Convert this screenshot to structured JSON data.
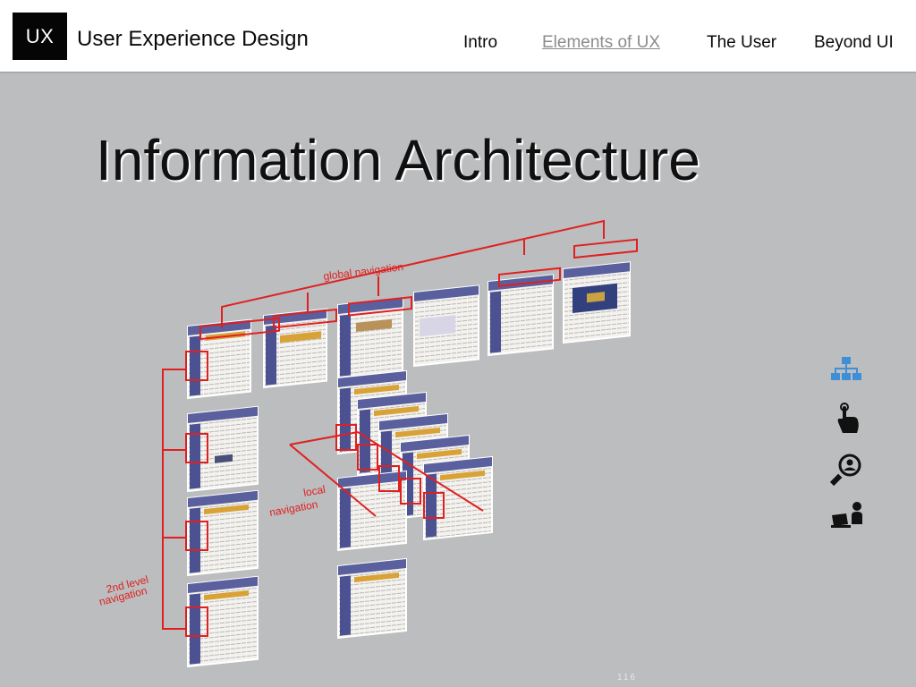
{
  "header": {
    "logo": "UX",
    "brand": "User Experience Design",
    "nav": [
      "Intro",
      "Elements of UX",
      "The User",
      "Beyond UI"
    ],
    "active_nav": "Elements of UX"
  },
  "slide": {
    "title": "Information Architecture",
    "labels": {
      "global": "global navigation",
      "local_1": "local",
      "local_2": "navigation",
      "second_1": "2nd level",
      "second_2": "navigation"
    },
    "page_number": "116"
  },
  "side_icons": [
    "sitemap-icon",
    "touch-hand-icon",
    "search-user-icon",
    "user-laptop-icon"
  ],
  "colors": {
    "accent_red": "#e02020",
    "icon_blue": "#3d8fd8",
    "icon_dark": "#111111",
    "background": "#bcbdbf"
  }
}
